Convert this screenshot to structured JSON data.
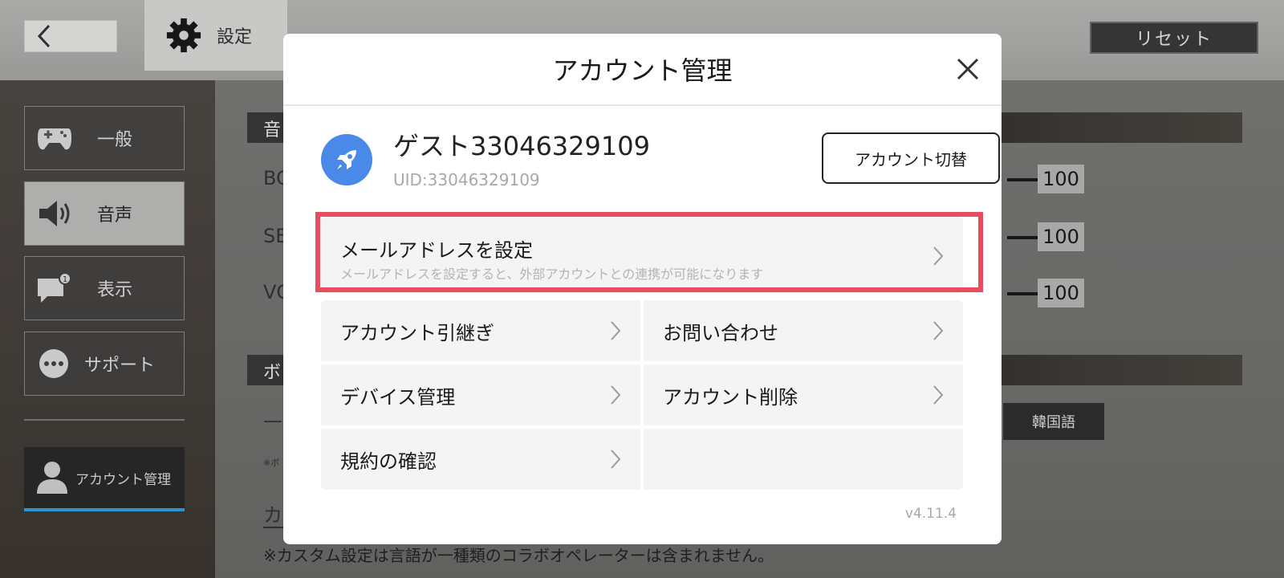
{
  "background": {
    "header": {
      "back_label": "<",
      "settings_label": "設定",
      "reset_label": "リセット"
    },
    "sidebar": {
      "items": [
        {
          "label": "一般",
          "icon": "gamepad-icon"
        },
        {
          "label": "音声",
          "icon": "speaker-icon"
        },
        {
          "label": "表示",
          "icon": "chat-bubble-icon"
        },
        {
          "label": "サポート",
          "icon": "dots-icon"
        }
      ],
      "account_label": "アカウント管理"
    },
    "main": {
      "sections": [
        "音",
        "ボ"
      ],
      "sliders": [
        {
          "label": "BC",
          "value": "100"
        },
        {
          "label": "SE",
          "value": "100"
        },
        {
          "label": "VC",
          "value": "100"
        }
      ],
      "korean_label": "韓国語",
      "custom_heading": "カ",
      "small_note": "※ボ",
      "dash": "—",
      "note": "※カスタム設定は言語が一種類のコラボオペレーターは含まれません。"
    }
  },
  "modal": {
    "title": "アカウント管理",
    "profile": {
      "username": "ゲスト33046329109",
      "uid": "UID:33046329109",
      "switch_label": "アカウント切替"
    },
    "email": {
      "title": "メールアドレスを設定",
      "description": "メールアドレスを設定すると、外部アカウントとの連携が可能になります"
    },
    "menu": [
      {
        "label": "アカウント引継ぎ"
      },
      {
        "label": "お問い合わせ"
      },
      {
        "label": "デバイス管理"
      },
      {
        "label": "アカウント削除"
      },
      {
        "label": "規約の確認"
      }
    ],
    "version": "v4.11.4"
  },
  "colors": {
    "highlight": "#e84c5e",
    "avatar_bg": "#4a89e8",
    "account_tab_accent": "#2ea3d8"
  }
}
